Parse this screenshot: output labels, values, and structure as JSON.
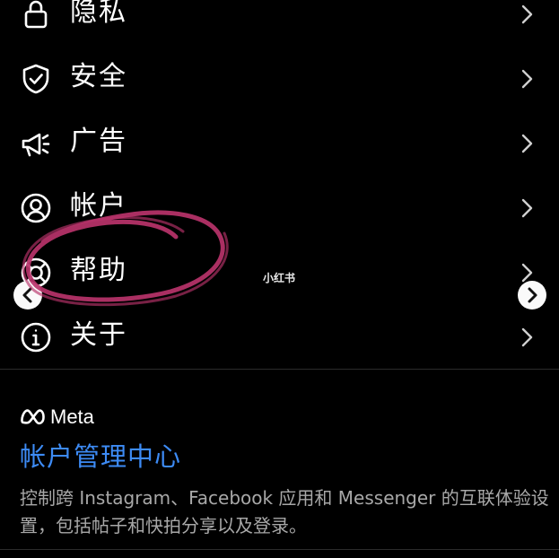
{
  "menu": {
    "items": [
      {
        "label": "隐私",
        "icon": "lock-icon"
      },
      {
        "label": "安全",
        "icon": "shield-check-icon"
      },
      {
        "label": "广告",
        "icon": "megaphone-icon"
      },
      {
        "label": "帐户",
        "icon": "account-circle-icon"
      },
      {
        "label": "帮助",
        "icon": "lifebuoy-icon"
      },
      {
        "label": "关于",
        "icon": "info-icon"
      }
    ]
  },
  "accounts_center": {
    "brand": "Meta",
    "title": "帐户管理中心",
    "description": "控制跨 Instagram、Facebook 应用和 Messenger 的互联体验设置，包括帖子和快拍分享以及登录。"
  },
  "watermark": "小红书",
  "colors": {
    "background": "#000000",
    "text": "#ffffff",
    "accent_link": "#3d8bf5",
    "secondary_text": "#a8a8a8",
    "annotation_stroke": "#b8336a"
  }
}
